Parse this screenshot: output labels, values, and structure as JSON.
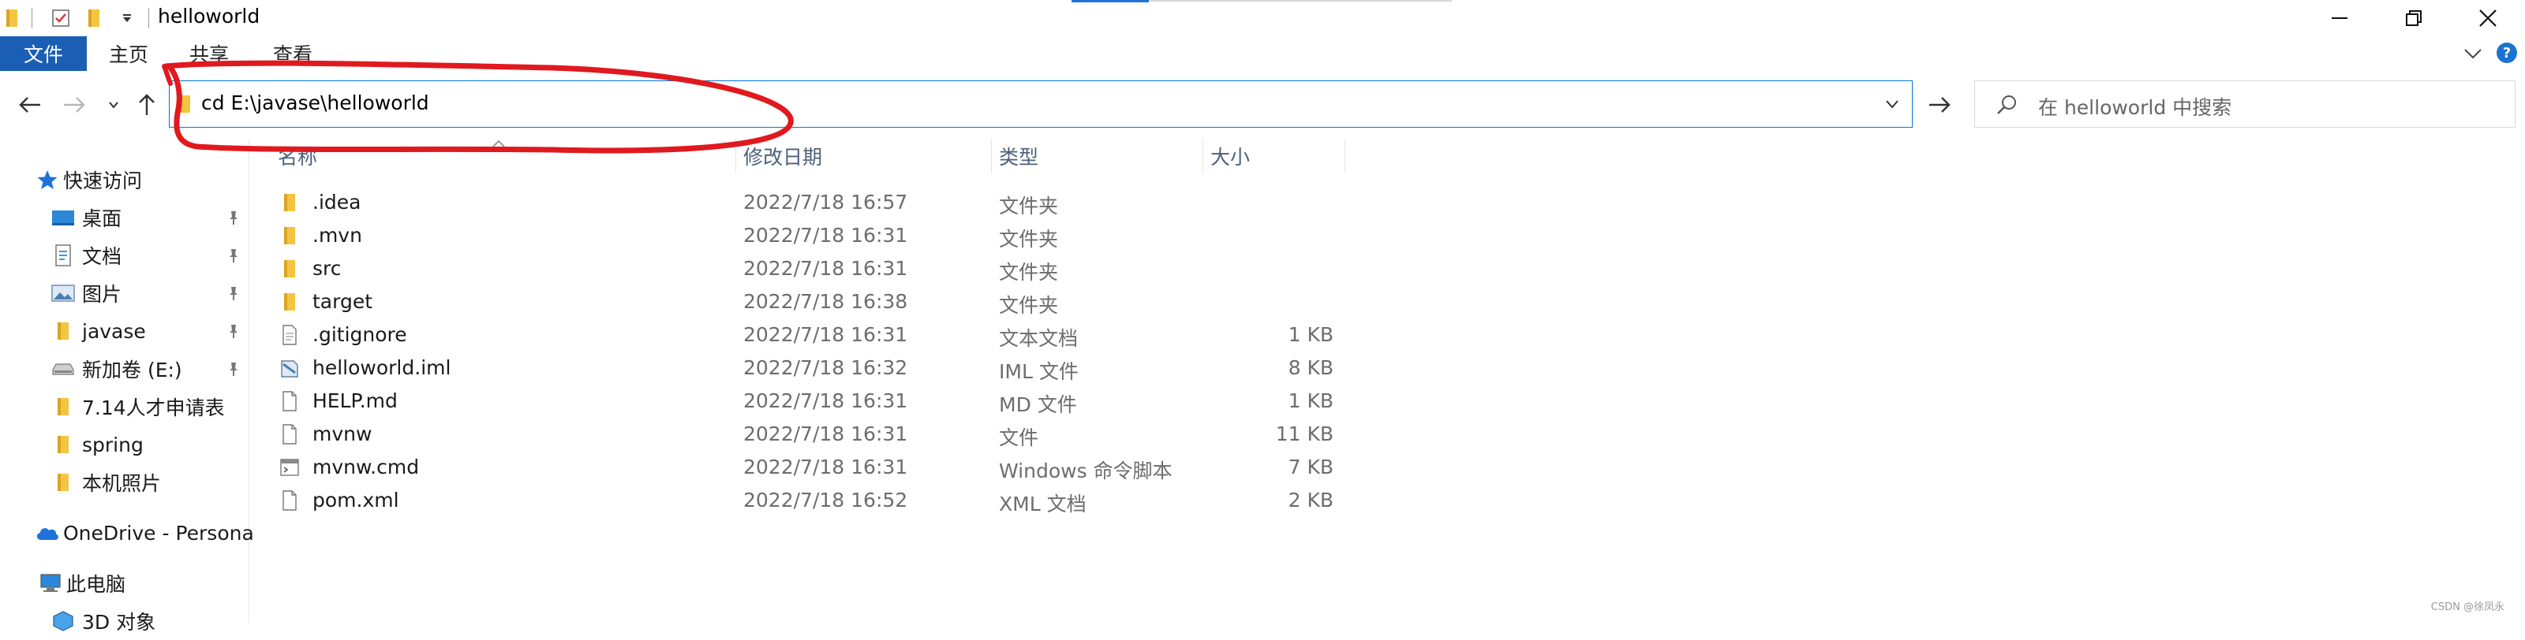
{
  "window": {
    "title": "helloworld",
    "controls": {
      "minimize_icon": "minimize-icon",
      "restore_icon": "restore-icon",
      "close_icon": "close-icon"
    }
  },
  "ribbon": {
    "file_tab": "文件",
    "tabs": [
      "主页",
      "共享",
      "查看"
    ]
  },
  "address": {
    "value": "cd E:\\javase\\helloworld"
  },
  "search": {
    "placeholder": "在 helloworld 中搜索"
  },
  "sidebar": {
    "quick_access": "快速访问",
    "items": [
      {
        "label": "桌面",
        "icon": "desktop-icon",
        "pinned": true
      },
      {
        "label": "文档",
        "icon": "documents-icon",
        "pinned": true
      },
      {
        "label": "图片",
        "icon": "pictures-icon",
        "pinned": true
      },
      {
        "label": "javase",
        "icon": "folder-icon",
        "pinned": true
      },
      {
        "label": "新加卷 (E:)",
        "icon": "drive-icon",
        "pinned": true
      },
      {
        "label": "7.14人才申请表",
        "icon": "folder-icon",
        "pinned": false
      },
      {
        "label": "spring",
        "icon": "folder-icon",
        "pinned": false
      },
      {
        "label": "本机照片",
        "icon": "folder-icon",
        "pinned": false
      }
    ],
    "onedrive": "OneDrive - Persona",
    "this_pc": "此电脑",
    "objects_3d": "3D 对象"
  },
  "columns": {
    "name": "名称",
    "date": "修改日期",
    "type": "类型",
    "size": "大小"
  },
  "files": [
    {
      "name": ".idea",
      "date": "2022/7/18 16:57",
      "type": "文件夹",
      "size": "",
      "icon": "folder-icon"
    },
    {
      "name": ".mvn",
      "date": "2022/7/18 16:31",
      "type": "文件夹",
      "size": "",
      "icon": "folder-icon"
    },
    {
      "name": "src",
      "date": "2022/7/18 16:31",
      "type": "文件夹",
      "size": "",
      "icon": "folder-icon"
    },
    {
      "name": "target",
      "date": "2022/7/18 16:38",
      "type": "文件夹",
      "size": "",
      "icon": "folder-icon"
    },
    {
      "name": ".gitignore",
      "date": "2022/7/18 16:31",
      "type": "文本文档",
      "size": "1 KB",
      "icon": "text-file-icon"
    },
    {
      "name": "helloworld.iml",
      "date": "2022/7/18 16:32",
      "type": "IML 文件",
      "size": "8 KB",
      "icon": "iml-file-icon"
    },
    {
      "name": "HELP.md",
      "date": "2022/7/18 16:31",
      "type": "MD 文件",
      "size": "1 KB",
      "icon": "file-icon"
    },
    {
      "name": "mvnw",
      "date": "2022/7/18 16:31",
      "type": "文件",
      "size": "11 KB",
      "icon": "file-icon"
    },
    {
      "name": "mvnw.cmd",
      "date": "2022/7/18 16:31",
      "type": "Windows 命令脚本",
      "size": "7 KB",
      "icon": "cmd-file-icon"
    },
    {
      "name": "pom.xml",
      "date": "2022/7/18 16:52",
      "type": "XML 文档",
      "size": "2 KB",
      "icon": "file-icon"
    }
  ],
  "watermark": "CSDN @徐凤永",
  "colors": {
    "accent": "#1a5fb4",
    "folder": "#f4c542",
    "annotation": "#e0191f"
  }
}
